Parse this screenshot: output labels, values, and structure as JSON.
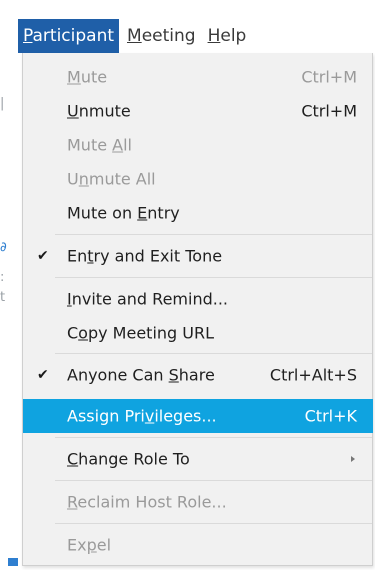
{
  "menubar": {
    "items": [
      {
        "pre": "",
        "mn": "P",
        "post": "articipant"
      },
      {
        "pre": "",
        "mn": "M",
        "post": "eeting"
      },
      {
        "pre": "",
        "mn": "H",
        "post": "elp"
      }
    ]
  },
  "menu": {
    "items": [
      {
        "pre": "",
        "mn": "M",
        "post": "ute",
        "shortcut": "Ctrl+M"
      },
      {
        "pre": "",
        "mn": "U",
        "post": "nmute",
        "shortcut": "Ctrl+M"
      },
      {
        "pre": "Mute ",
        "mn": "A",
        "post": "ll"
      },
      {
        "pre": "U",
        "mn": "n",
        "post": "mute All"
      },
      {
        "pre": "Mute on ",
        "mn": "E",
        "post": "ntry"
      },
      {
        "pre": "En",
        "mn": "t",
        "post": "ry and Exit Tone",
        "check": "✔"
      },
      {
        "pre": "",
        "mn": "I",
        "post": "nvite and Remind..."
      },
      {
        "pre": "C",
        "mn": "o",
        "post": "py Meeting URL"
      },
      {
        "pre": "Anyone Can ",
        "mn": "S",
        "post": "hare",
        "shortcut": "Ctrl+Alt+S",
        "check": "✔"
      },
      {
        "pre": "Assign Pri",
        "mn": "v",
        "post": "ileges...",
        "shortcut": "Ctrl+K"
      },
      {
        "pre": "",
        "mn": "C",
        "post": "hange Role To"
      },
      {
        "pre": "",
        "mn": "R",
        "post": "eclaim Host Role..."
      },
      {
        "pre": "Ex",
        "mn": "p",
        "post": "el"
      }
    ]
  },
  "colors": {
    "menubar_active": "#1f5fa8",
    "highlight": "#0fa3e0",
    "disabled_text": "#9a9a9a"
  }
}
